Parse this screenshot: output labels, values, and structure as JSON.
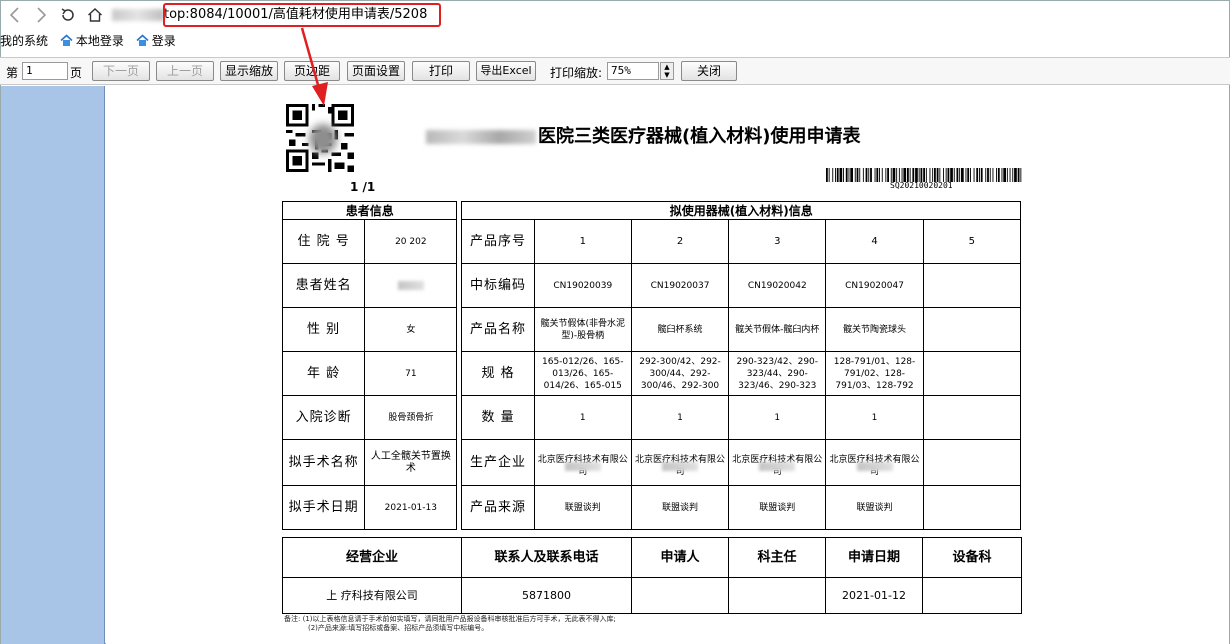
{
  "browser": {
    "url_visible": "top:8084/10001/高值耗材使用申请表/5208",
    "icons": [
      "back-icon",
      "forward-icon",
      "refresh-icon",
      "home-icon"
    ]
  },
  "bookmarks": [
    {
      "label": "我的系统",
      "icon": ""
    },
    {
      "label": "本地登录",
      "icon": "home-icon"
    },
    {
      "label": "登录",
      "icon": "home-icon"
    }
  ],
  "toolbar": {
    "page_prefix": "第",
    "page_value": "1",
    "page_suffix": "页",
    "next_label": "下一页",
    "prev_label": "上一页",
    "zoom_display_label": "显示缩放",
    "margins_label": "页边距",
    "page_setup_label": "页面设置",
    "print_label": "打印",
    "export_label": "导出Excel",
    "print_zoom_label": "打印缩放:",
    "print_zoom_value": "75%",
    "close_label": "关闭"
  },
  "doc": {
    "title_suffix": "医院三类医疗器械(植入材料)使用申请表",
    "page_indicator": "1 /1",
    "barcode_number": "SQ20210020201",
    "patient_header": "患者信息",
    "device_header": "拟使用器械(植入材料)信息",
    "patient_rows": [
      {
        "label": "住 院 号",
        "value": "20      202"
      },
      {
        "label": "患者姓名",
        "value": ""
      },
      {
        "label": "性 别",
        "value": "女"
      },
      {
        "label": "年 龄",
        "value": "71"
      },
      {
        "label": "入院诊断",
        "value": "股骨颈骨折"
      },
      {
        "label": "拟手术名称",
        "value": "人工全髋关节置换术"
      },
      {
        "label": "拟手术日期",
        "value": "2021-01-13"
      }
    ],
    "device_rows": [
      {
        "label": "产品序号",
        "cells": [
          "1",
          "2",
          "3",
          "4",
          "5"
        ]
      },
      {
        "label": "中标编码",
        "cells": [
          "CN19020039",
          "CN19020037",
          "CN19020042",
          "CN19020047",
          ""
        ]
      },
      {
        "label": "产品名称",
        "cells": [
          "髋关节假体(非骨水泥型)-股骨柄",
          "髋臼杯系统",
          "髋关节假体-髋臼内杯",
          "髋关节陶瓷球头",
          ""
        ]
      },
      {
        "label": "规 格",
        "cells": [
          "165-012/26、165-013/26、165-014/26、165-015",
          "292-300/42、292-300/44、292-300/46、292-300",
          "290-323/42、290-323/44、290-323/46、290-323",
          "128-791/01、128-791/02、128-791/03、128-792",
          ""
        ]
      },
      {
        "label": "数 量",
        "cells": [
          "1",
          "1",
          "1",
          "1",
          ""
        ]
      },
      {
        "label": "生产企业",
        "cells": [
          "北京医疗科技术有限公司",
          "北京医疗科技术有限公司",
          "北京医疗科技术有限公司",
          "北京医疗科技术有限公司",
          ""
        ]
      },
      {
        "label": "产品来源",
        "cells": [
          "联盟谈判",
          "联盟谈判",
          "联盟谈判",
          "联盟谈判",
          ""
        ]
      }
    ],
    "bottom_headers": [
      "经营企业",
      "联系人及联系电话",
      "申请人",
      "科主任",
      "申请日期",
      "设备科"
    ],
    "bottom_values": [
      "上        疗科技有限公司",
      "5871800",
      "",
      "",
      "2021-01-12",
      ""
    ],
    "notes": [
      "备注: (1)以上表格信息请于手术前如实填写，请同批用户品报设备科审核批准后方可手术，无此表不得入库;",
      "(2)产品来源:填写招标或备案、招标产品须填写中标编号。"
    ]
  }
}
